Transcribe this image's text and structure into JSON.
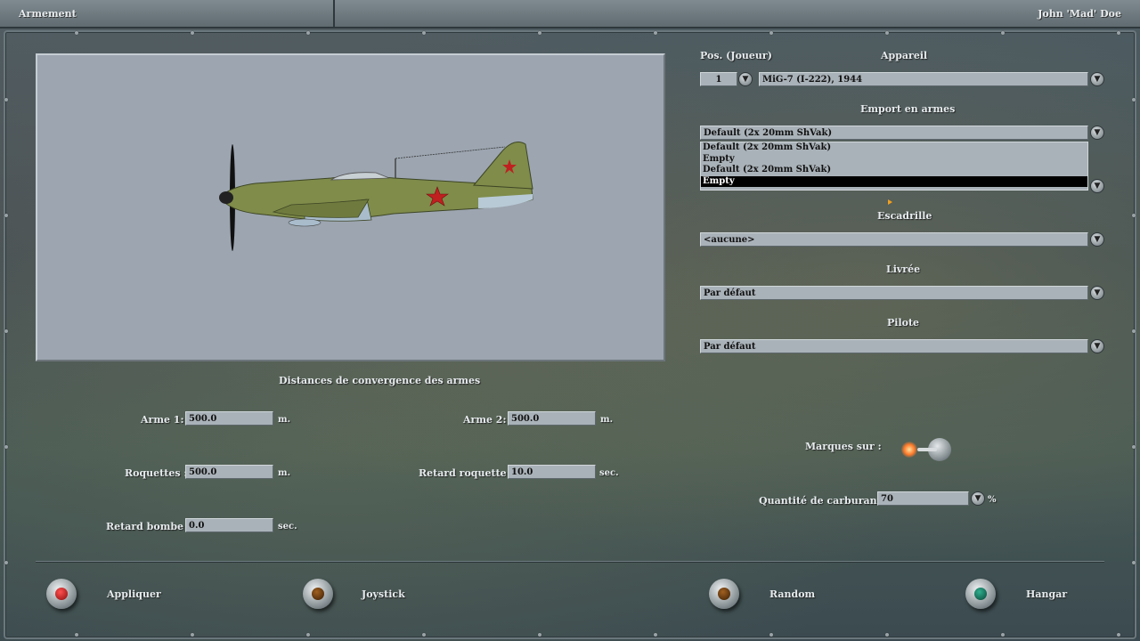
{
  "header": {
    "left_title": "Armement",
    "right_title": "John 'Mad' Doe"
  },
  "labels": {
    "pos": "Pos. (Joueur)",
    "aircraft": "Appareil",
    "loadout": "Emport en armes",
    "squadron": "Escadrille",
    "livery": "Livrée",
    "pilot": "Pilote",
    "convergence": "Distances de convergence des armes",
    "weapon1": "Arme 1:",
    "weapon2": "Arme 2:",
    "rockets": "Roquettes :",
    "rocket_delay": "Retard roquette :",
    "bomb_delay": "Retard bombe :",
    "markings": "Marques sur :",
    "fuel": "Quantité de carburant :"
  },
  "values": {
    "pos": "1",
    "aircraft": "MiG-7 (I-222), 1944",
    "loadout": "Default (2x 20mm ShVak)",
    "squadron": "<aucune>",
    "livery": "Par défaut",
    "pilot": "Par défaut",
    "weapon1": "500.0",
    "weapon2": "500.0",
    "rockets": "500.0",
    "rocket_delay": "10.0",
    "bomb_delay": "0.0",
    "fuel": "70"
  },
  "units": {
    "m": "m.",
    "sec": "sec.",
    "percent": "%"
  },
  "loadout_options": [
    "Default (2x 20mm ShVak)",
    "Empty",
    "Default (2x 20mm ShVak)",
    "Empty"
  ],
  "loadout_selected_index": 3,
  "buttons": {
    "apply": "Appliquer",
    "joystick": "Joystick",
    "random": "Random",
    "hangar": "Hangar"
  },
  "colors": {
    "apply_lamp": "#b01818",
    "joystick_lamp": "#5a3208",
    "random_lamp": "#5a3208",
    "hangar_lamp": "#0e6a55",
    "markings_on": "#ff6a20"
  }
}
